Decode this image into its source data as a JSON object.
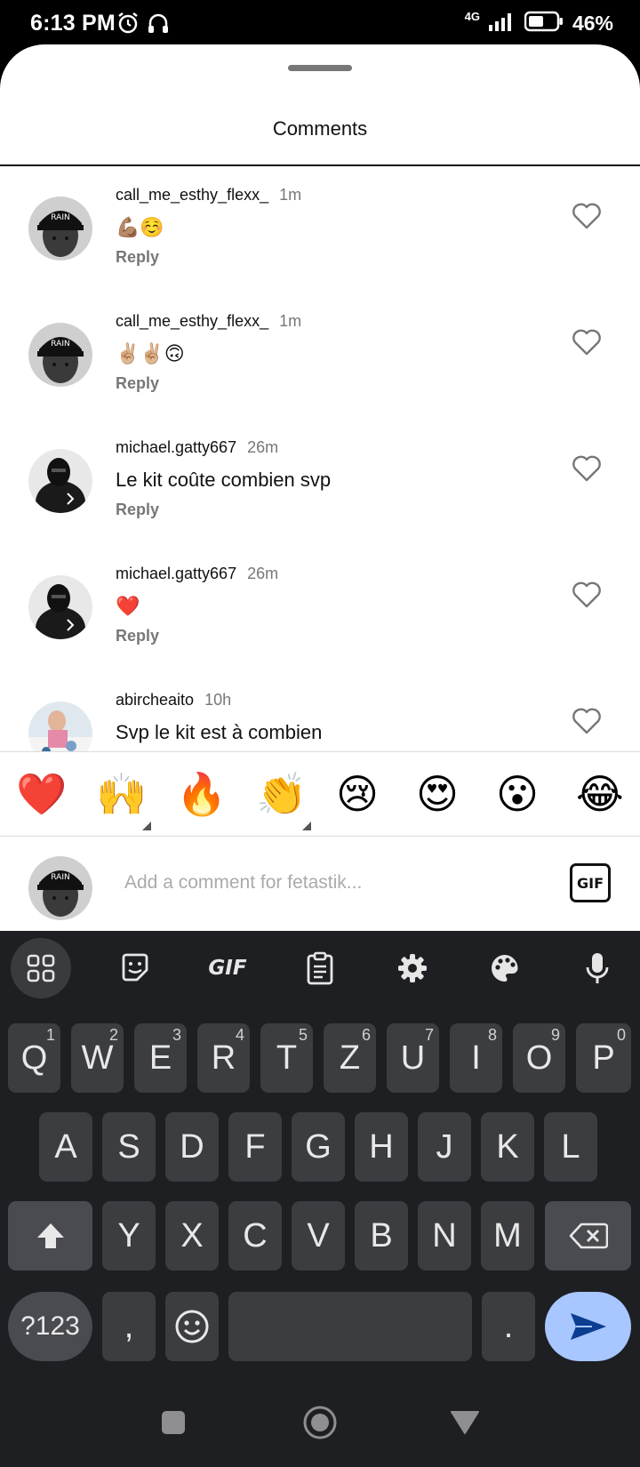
{
  "status_bar": {
    "time": "6:13 PM",
    "network": "4G",
    "battery_pct": "46%"
  },
  "sheet": {
    "title": "Comments"
  },
  "comments": [
    {
      "username": "call_me_esthy_flexx_",
      "time": "1m",
      "text": "💪🏽☺️",
      "reply": "Reply"
    },
    {
      "username": "call_me_esthy_flexx_",
      "time": "1m",
      "text": "✌🏼✌🏼🙃",
      "reply": "Reply"
    },
    {
      "username": "michael.gatty667",
      "time": "26m",
      "text": "Le kit coûte combien svp",
      "reply": "Reply"
    },
    {
      "username": "michael.gatty667",
      "time": "26m",
      "text": "❤️",
      "reply": "Reply"
    },
    {
      "username": "abircheaito",
      "time": "10h",
      "text": "Svp le kit est à combien",
      "reply": "Reply"
    }
  ],
  "emoji_bar": [
    "❤️",
    "🙌",
    "🔥",
    "👏",
    "😢",
    "😍",
    "😮",
    "😂"
  ],
  "compose": {
    "placeholder": "Add a comment for fetastik...",
    "gif_label": "GIF"
  },
  "keyboard": {
    "toolbar": {
      "gif_label": "GIF",
      "icons": [
        "apps-grid-icon",
        "sticker-icon",
        "gif-icon",
        "clipboard-icon",
        "settings-gear-icon",
        "theme-palette-icon",
        "microphone-icon"
      ]
    },
    "row1": [
      {
        "key": "Q",
        "hint": "1"
      },
      {
        "key": "W",
        "hint": "2"
      },
      {
        "key": "E",
        "hint": "3"
      },
      {
        "key": "R",
        "hint": "4"
      },
      {
        "key": "T",
        "hint": "5"
      },
      {
        "key": "Z",
        "hint": "6"
      },
      {
        "key": "U",
        "hint": "7"
      },
      {
        "key": "I",
        "hint": "8"
      },
      {
        "key": "O",
        "hint": "9"
      },
      {
        "key": "P",
        "hint": "0"
      }
    ],
    "row2": [
      "A",
      "S",
      "D",
      "F",
      "G",
      "H",
      "J",
      "K",
      "L"
    ],
    "row3": [
      "Y",
      "X",
      "C",
      "V",
      "B",
      "N",
      "M"
    ],
    "sym_label": "?123",
    "comma": ",",
    "period": ".",
    "accent_color": "#a8c6ff"
  }
}
